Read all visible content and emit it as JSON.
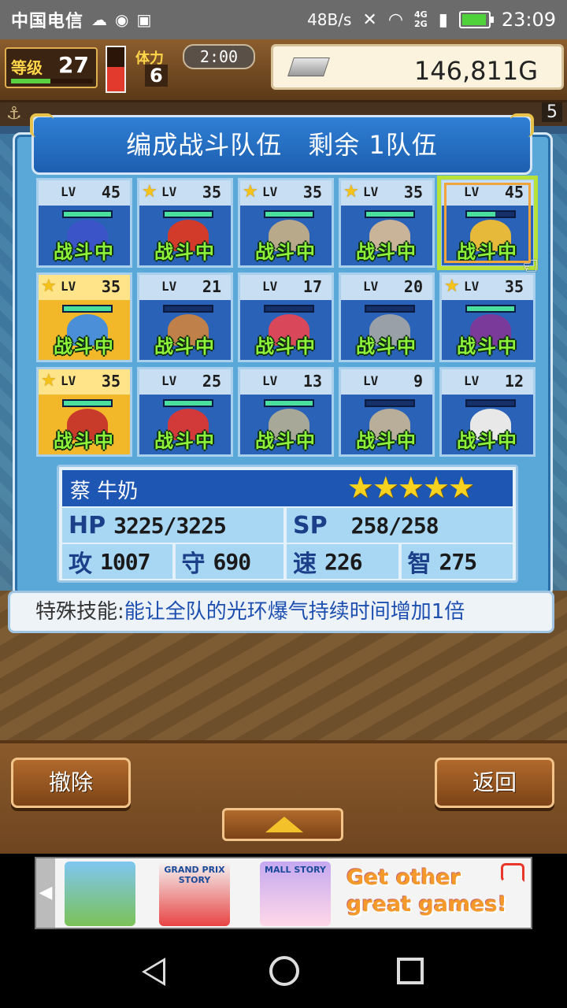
{
  "statusbar": {
    "carrier": "中国电信",
    "icons": [
      "cloud-icon",
      "q-app-icon",
      "image-icon"
    ],
    "speed": "48B/s",
    "net_top": "4G",
    "net_bottom": "2G",
    "time": "23:09"
  },
  "hud": {
    "level_label": "等级",
    "level": "27",
    "stamina_label": "体力",
    "stamina": "6",
    "timer": "2:00",
    "gold": "146,811G",
    "sub_right": "5"
  },
  "panel": {
    "title": "编成战斗队伍　剩余 1队伍"
  },
  "cards": [
    {
      "lv": "45",
      "fav": false,
      "star": false,
      "status": "战斗中",
      "hp": 1.0,
      "color": "#3b55c8"
    },
    {
      "lv": "35",
      "fav": false,
      "star": true,
      "status": "战斗中",
      "hp": 1.0,
      "color": "#d23a2a"
    },
    {
      "lv": "35",
      "fav": false,
      "star": true,
      "status": "战斗中",
      "hp": 1.0,
      "color": "#b8a98a"
    },
    {
      "lv": "35",
      "fav": false,
      "star": true,
      "status": "战斗中",
      "hp": 1.0,
      "color": "#c9b49a"
    },
    {
      "lv": "45",
      "fav": false,
      "star": false,
      "status": "战斗中",
      "hp": 0.6,
      "color": "#e6b93a",
      "selected": true
    },
    {
      "lv": "35",
      "fav": true,
      "star": true,
      "status": "战斗中",
      "hp": 1.0,
      "color": "#4a8fd8"
    },
    {
      "lv": "21",
      "fav": false,
      "star": false,
      "status": "战斗中",
      "hp": 0.0,
      "color": "#c0804a"
    },
    {
      "lv": "17",
      "fav": false,
      "star": false,
      "status": "战斗中",
      "hp": 0.0,
      "color": "#d8485a"
    },
    {
      "lv": "20",
      "fav": false,
      "star": false,
      "status": "战斗中",
      "hp": 0.0,
      "color": "#9aa0a8"
    },
    {
      "lv": "35",
      "fav": false,
      "star": true,
      "status": "战斗中",
      "hp": 1.0,
      "color": "#7a3a9a"
    },
    {
      "lv": "35",
      "fav": true,
      "star": true,
      "status": "战斗中",
      "hp": 1.0,
      "color": "#c83a2a"
    },
    {
      "lv": "25",
      "fav": false,
      "star": false,
      "status": "战斗中",
      "hp": 1.0,
      "color": "#d23a3a"
    },
    {
      "lv": "13",
      "fav": false,
      "star": false,
      "status": "战斗中",
      "hp": 1.0,
      "color": "#a8a898"
    },
    {
      "lv": "9",
      "fav": false,
      "star": false,
      "status": "战斗中",
      "hp": 0.0,
      "color": "#b8ae9a"
    },
    {
      "lv": "12",
      "fav": false,
      "star": false,
      "status": "战斗中",
      "hp": 0.0,
      "color": "#e8e8e8"
    }
  ],
  "lv_prefix": "LV",
  "info": {
    "name": "蔡 牛奶",
    "stars": "★★★★★",
    "hp_label": "HP",
    "hp": "3225/3225",
    "sp_label": "SP",
    "sp": "258/258",
    "atk_label": "攻",
    "atk": "1007",
    "def_label": "守",
    "def": "690",
    "spd_label": "速",
    "spd": "226",
    "int_label": "智",
    "int": "275"
  },
  "skill": {
    "label": "特殊技能:",
    "text": "能让全队的光环爆气持续时间增加1倍"
  },
  "buttons": {
    "remove": "撤除",
    "back": "返回"
  },
  "ad": {
    "game1": "",
    "game2": "GRAND PRIX STORY",
    "game3": "MALL STORY",
    "promo": "Get other great games!"
  }
}
